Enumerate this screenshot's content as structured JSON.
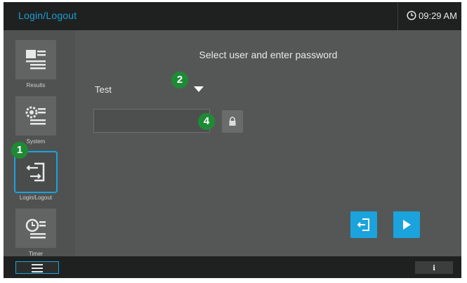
{
  "header": {
    "title": "Login/Logout",
    "clock_icon": "clock-icon",
    "time": "09:29 AM"
  },
  "sidebar": {
    "items": [
      {
        "label": "Results",
        "icon": "results-icon"
      },
      {
        "label": "System",
        "icon": "system-settings-icon"
      },
      {
        "label": "Login/Logout",
        "icon": "login-logout-icon",
        "active": true
      },
      {
        "label": "Timer",
        "icon": "timer-icon"
      }
    ]
  },
  "main": {
    "prompt": "Select user and enter password",
    "selected_user": "Test",
    "password_value": "",
    "password_placeholder": ""
  },
  "callouts": [
    "1",
    "2",
    "4"
  ],
  "bottom": {
    "info_label": "i"
  },
  "colors": {
    "accent": "#1aa3dc",
    "background": "#555756",
    "bar": "#1f2121",
    "callout": "#1f8a36"
  }
}
